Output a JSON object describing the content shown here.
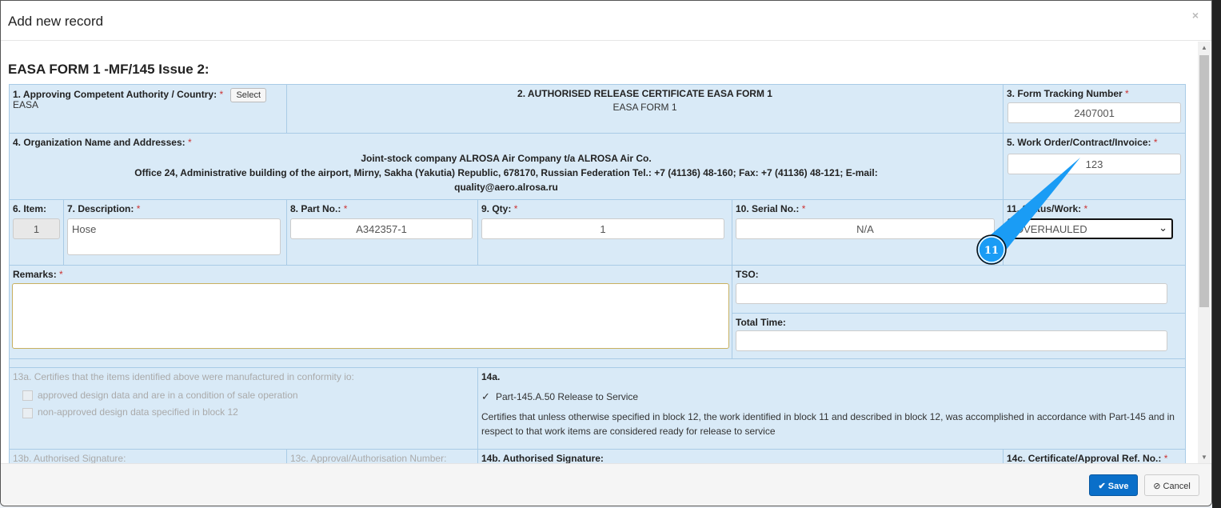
{
  "dialog": {
    "title": "Add new record",
    "close": "×",
    "save": "Save",
    "cancel": "Cancel",
    "save_icon": "✔",
    "cancel_icon": "⊘"
  },
  "form": {
    "heading": "EASA FORM 1 -MF/145 Issue 2:",
    "f1": {
      "label": "1. Approving Competent Authority / Country:",
      "select": "Select",
      "value": "EASA"
    },
    "f2": {
      "label": "2. AUTHORISED RELEASE CERTIFICATE EASA FORM 1",
      "value": "EASA FORM 1"
    },
    "f3": {
      "label": "3. Form Tracking Number",
      "value": "2407001"
    },
    "f4": {
      "label": "4. Organization Name and Addresses:",
      "line1": "Joint-stock company ALROSA Air Company t/a ALROSA Air Co.",
      "line2": "Office 24, Administrative building of the airport, Mirny, Sakha (Yakutia) Republic, 678170, Russian Federation Tel.: +7 (41136) 48-160; Fax: +7 (41136) 48-121; E-mail:",
      "line3": "quality@aero.alrosa.ru"
    },
    "f5": {
      "label": "5. Work Order/Contract/Invoice:",
      "value": "123"
    },
    "f6": {
      "label": "6. Item:",
      "value": "1"
    },
    "f7": {
      "label": "7. Description:",
      "value": "Hose"
    },
    "f8": {
      "label": "8. Part No.:",
      "value": "A342357-1"
    },
    "f9": {
      "label": "9. Qty:",
      "value": "1"
    },
    "f10": {
      "label": "10. Serial No.:",
      "value": "N/A"
    },
    "f11": {
      "label": "11. Status/Work:",
      "value": "OVERHAULED"
    },
    "remarks": {
      "label": "Remarks:",
      "value": ""
    },
    "tso": {
      "label": "TSO:",
      "value": ""
    },
    "total_time": {
      "label": "Total Time:",
      "value": ""
    },
    "f13a": {
      "label": "13a. Certifies that the items identified above were manufactured in conformity io:",
      "opt1": "approved design data and are in a condition of sale operation",
      "opt2": "non-approved design data specified in block 12"
    },
    "f14a": {
      "label": "14a.",
      "check": "Part-145.A.50 Release to Service",
      "text": "Certifies that unless otherwise specified in block 12, the work identified in block 11 and described in block 12, was accomplished in accordance with Part-145 and in respect to that work items are considered ready for release to service"
    },
    "f13b": {
      "label": "13b. Authorised Signature:"
    },
    "f13c": {
      "label": "13c. Approval/Authorisation Number:"
    },
    "f14b": {
      "label": "14b. Authorised Signature:"
    },
    "f14c": {
      "label": "14c. Certificate/Approval Ref. No.:"
    }
  },
  "annotation": {
    "label": "11",
    "color": "#1a9cf5"
  }
}
